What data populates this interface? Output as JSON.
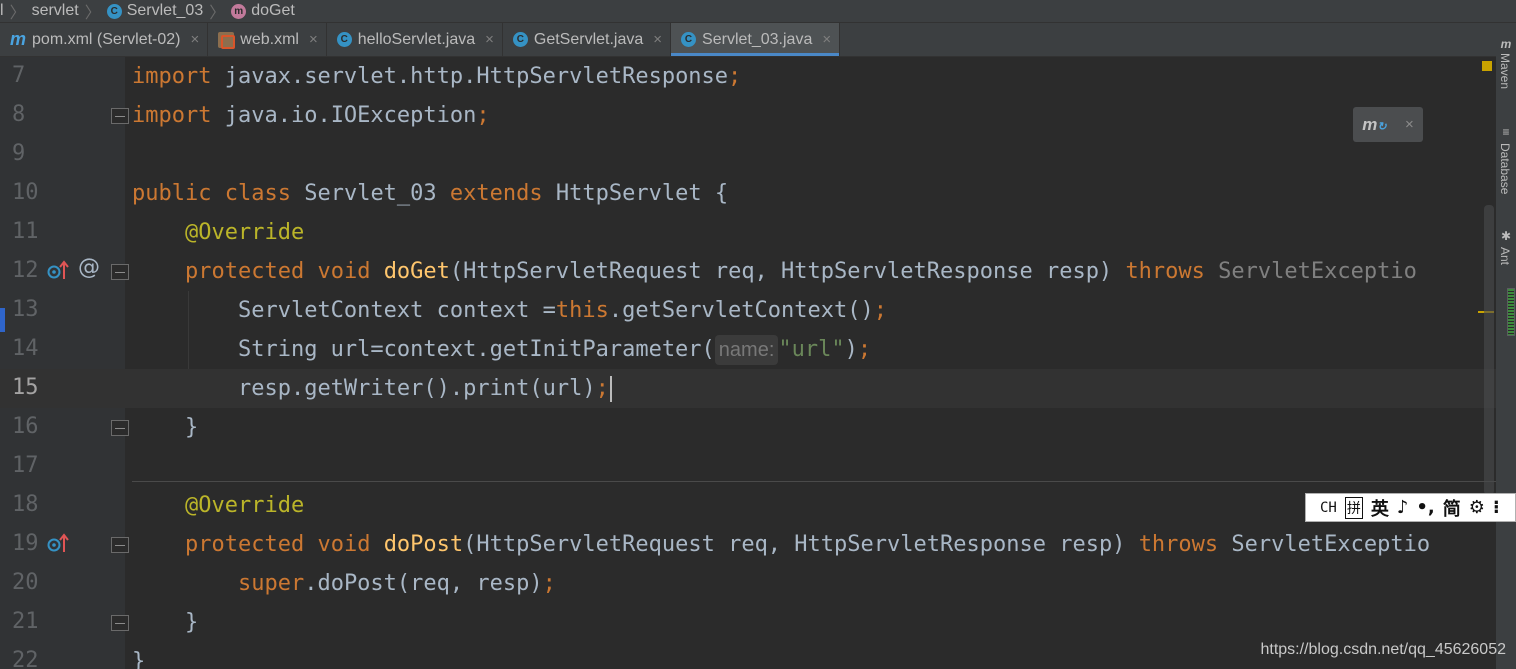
{
  "breadcrumb": {
    "items": [
      {
        "label": "servlet"
      },
      {
        "label": "Servlet_03",
        "kind": "class"
      },
      {
        "label": "doGet",
        "kind": "method"
      }
    ]
  },
  "tabs": [
    {
      "label": "pom.xml (Servlet-02)",
      "icon": "maven-icon",
      "close": "×",
      "active": false
    },
    {
      "label": "web.xml",
      "icon": "xml-file-icon",
      "close": "×",
      "active": false
    },
    {
      "label": "helloServlet.java",
      "icon": "class-icon",
      "close": "×",
      "active": false
    },
    {
      "label": "GetServlet.java",
      "icon": "class-icon",
      "close": "×",
      "active": false
    },
    {
      "label": "Servlet_03.java",
      "icon": "class-icon",
      "close": "×",
      "active": true
    }
  ],
  "right_tools": {
    "maven": "Maven",
    "database": "Database",
    "ant": "Ant"
  },
  "editor": {
    "line_numbers": [
      "7",
      "8",
      "9",
      "10",
      "11",
      "12",
      "13",
      "14",
      "15",
      "16",
      "17",
      "18",
      "19",
      "20",
      "21",
      "22"
    ],
    "current_line": "15",
    "lines": {
      "l7_kw": "import",
      "l7_rest": " javax.servlet.http.HttpServletResponse",
      "l7_semi": ";",
      "l8_kw": "import",
      "l8_rest": " java.io.IOException",
      "l8_semi": ";",
      "l10_kw1": "public",
      "l10_kw2": "class",
      "l10_name": " Servlet_03 ",
      "l10_kw3": "extends",
      "l10_rest": " HttpServlet {",
      "l11_ann": "@Override",
      "l12_kw1": "protected",
      "l12_kw2": "void",
      "l12_method": "doGet",
      "l12_params": "(HttpServletRequest req, HttpServletResponse resp) ",
      "l12_throws": "throws",
      "l12_exc": " ServletExceptio",
      "l13_a": "ServletContext context =",
      "l13_this": "this",
      "l13_b": ".getServletContext()",
      "l13_semi": ";",
      "l14_a": "String url=context.getInitParameter(",
      "l14_hint": "name:",
      "l14_str": "\"url\"",
      "l14_b": ")",
      "l14_semi": ";",
      "l15_a": "resp.getWriter().print(url)",
      "l15_semi": ";",
      "l16": "}",
      "l18_ann": "@Override",
      "l19_kw1": "protected",
      "l19_kw2": "void",
      "l19_method": "doPost",
      "l19_params": "(HttpServletRequest req, HttpServletResponse resp) ",
      "l19_throws": "throws",
      "l19_exc": " ServletExceptio",
      "l20_super": "super",
      "l20_rest": ".doPost(req, resp)",
      "l20_semi": ";",
      "l21": "}",
      "l22": "}"
    }
  },
  "maven_popup": {
    "close": "×"
  },
  "ime_bar": {
    "items": [
      "CH",
      "拼",
      "英",
      "♪",
      "•,",
      "简",
      "⚙",
      "⁝"
    ]
  },
  "watermark": "https://blog.csdn.net/qq_45626052"
}
